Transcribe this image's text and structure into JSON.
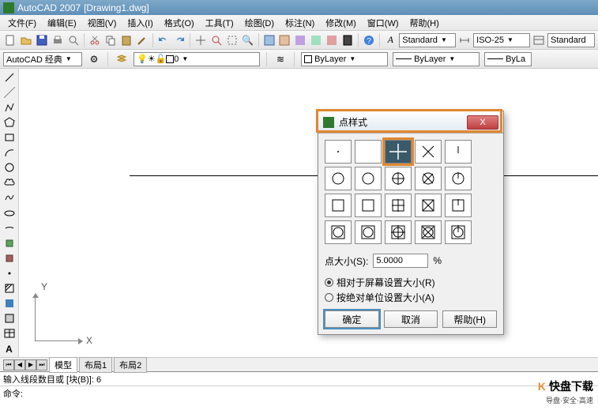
{
  "title": {
    "app": "AutoCAD 2007",
    "doc": "[Drawing1.dwg]"
  },
  "menu": [
    "文件(F)",
    "编辑(E)",
    "视图(V)",
    "插入(I)",
    "格式(O)",
    "工具(T)",
    "绘图(D)",
    "标注(N)",
    "修改(M)",
    "窗口(W)",
    "帮助(H)"
  ],
  "workspace": {
    "label": "AutoCAD 经典"
  },
  "styles": {
    "text_style": "Standard",
    "dim_style": "ISO-25",
    "table_style": "Standard"
  },
  "layers": {
    "current": "0",
    "color_combo": "ByLayer",
    "linetype_combo": "ByLayer",
    "lineweight_combo": "ByLa"
  },
  "tabs": {
    "model": "模型",
    "layout1": "布局1",
    "layout2": "布局2"
  },
  "command": {
    "line1": "输入线段数目或 [块(B)]: 6",
    "line2": "命令:"
  },
  "ucs": {
    "x": "X",
    "y": "Y"
  },
  "dialog": {
    "title": "点样式",
    "size_label": "点大小(S):",
    "size_value": "5.0000",
    "size_unit": "%",
    "radio1": "相对于屏幕设置大小(R)",
    "radio2": "按绝对单位设置大小(A)",
    "ok": "确定",
    "cancel": "取消",
    "help": "帮助(H)",
    "close": "X"
  },
  "watermark": {
    "text": "快盘下载",
    "sub": "导盘·安全·高速"
  }
}
